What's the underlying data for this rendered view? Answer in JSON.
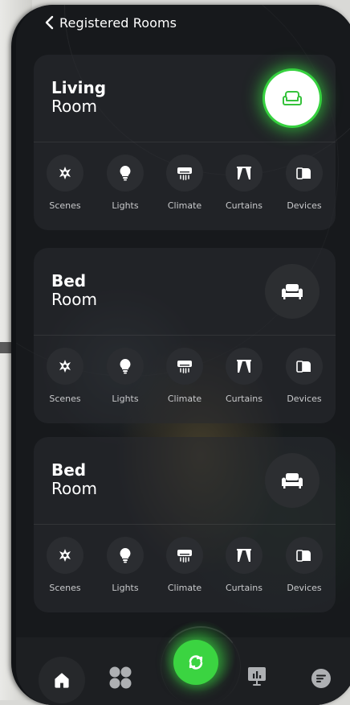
{
  "header": {
    "title": "Registered Rooms",
    "back_icon": "chevron-left-icon"
  },
  "rooms": [
    {
      "name_line1": "Living",
      "name_line2": "Room",
      "icon": "sofa-icon",
      "active": true,
      "controls": [
        {
          "label": "Scenes",
          "icon": "sparkle-icon"
        },
        {
          "label": "Lights",
          "icon": "bulb-icon"
        },
        {
          "label": "Climate",
          "icon": "air-conditioner-icon"
        },
        {
          "label": "Curtains",
          "icon": "curtains-icon"
        },
        {
          "label": "Devices",
          "icon": "devices-icon"
        }
      ]
    },
    {
      "name_line1": "Bed",
      "name_line2": "Room",
      "icon": "couch-icon",
      "active": false,
      "controls": [
        {
          "label": "Scenes",
          "icon": "sparkle-icon"
        },
        {
          "label": "Lights",
          "icon": "bulb-icon"
        },
        {
          "label": "Climate",
          "icon": "air-conditioner-icon"
        },
        {
          "label": "Curtains",
          "icon": "curtains-icon"
        },
        {
          "label": "Devices",
          "icon": "devices-icon"
        }
      ]
    },
    {
      "name_line1": "Bed",
      "name_line2": "Room",
      "icon": "couch-icon",
      "active": false,
      "controls": [
        {
          "label": "Scenes",
          "icon": "sparkle-icon"
        },
        {
          "label": "Lights",
          "icon": "bulb-icon"
        },
        {
          "label": "Climate",
          "icon": "air-conditioner-icon"
        },
        {
          "label": "Curtains",
          "icon": "curtains-icon"
        },
        {
          "label": "Devices",
          "icon": "devices-icon"
        }
      ]
    }
  ],
  "nav": {
    "items": [
      "home-icon",
      "grid-icon",
      "sync-icon",
      "presentation-chart-icon",
      "menu-icon"
    ],
    "active": "home-icon"
  },
  "colors": {
    "accent": "#3bd441",
    "card": "#28292d",
    "text": "#ffffff",
    "label": "#c9cacc",
    "icon_bg": "#2b2d31"
  }
}
